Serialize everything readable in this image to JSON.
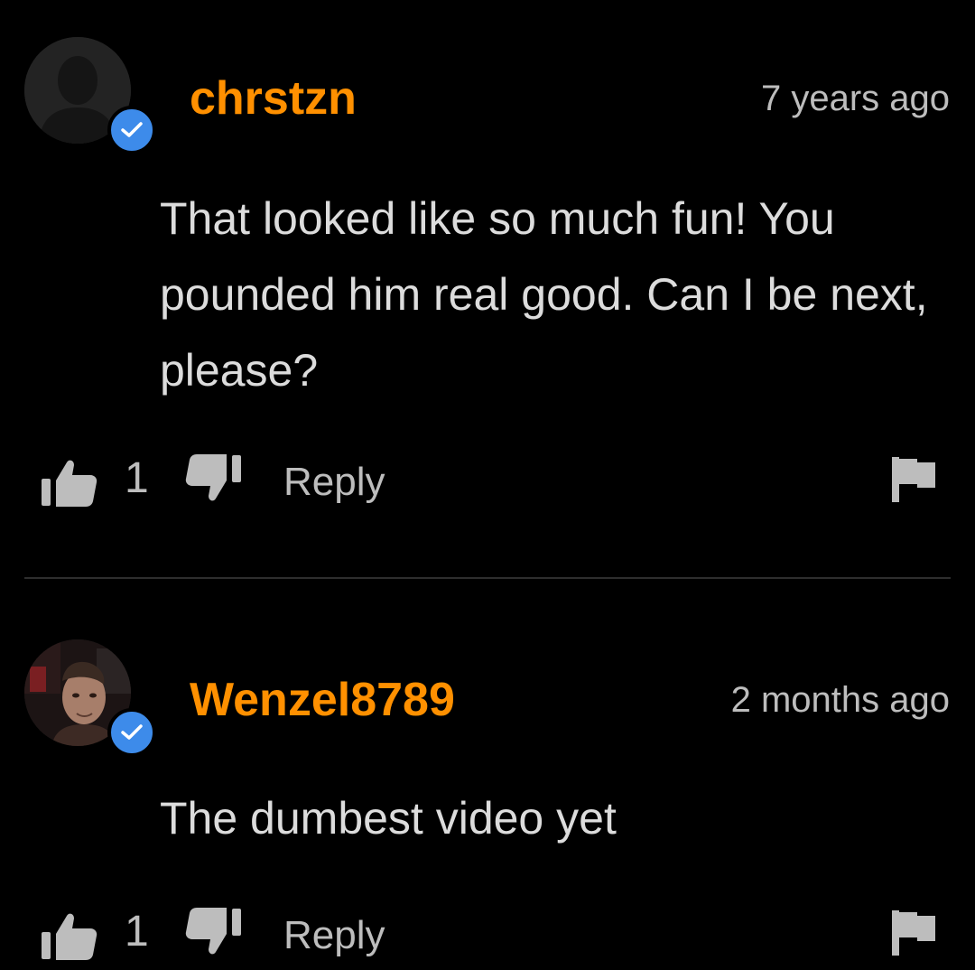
{
  "comments": [
    {
      "username": "chrstzn",
      "timestamp": "7 years ago",
      "text": "That looked like so much fun! You pounded him real good. Can I be next, please?",
      "likes": "1",
      "reply_label": "Reply",
      "verified": true,
      "avatar": "default-silhouette"
    },
    {
      "username": "Wenzel8789",
      "timestamp": "2 months ago",
      "text": "The dumbest video yet",
      "likes": "1",
      "reply_label": "Reply",
      "verified": true,
      "avatar": "user-photo"
    }
  ],
  "colors": {
    "background": "#000000",
    "username": "#ff9000",
    "verified_badge": "#3d8bea",
    "text": "#dcdcdc",
    "muted": "#bdbdbd",
    "divider": "#2e2e2e"
  },
  "icons": {
    "like": "thumbs-up-icon",
    "dislike": "thumbs-down-icon",
    "flag": "flag-icon",
    "verified": "checkmark-icon"
  }
}
